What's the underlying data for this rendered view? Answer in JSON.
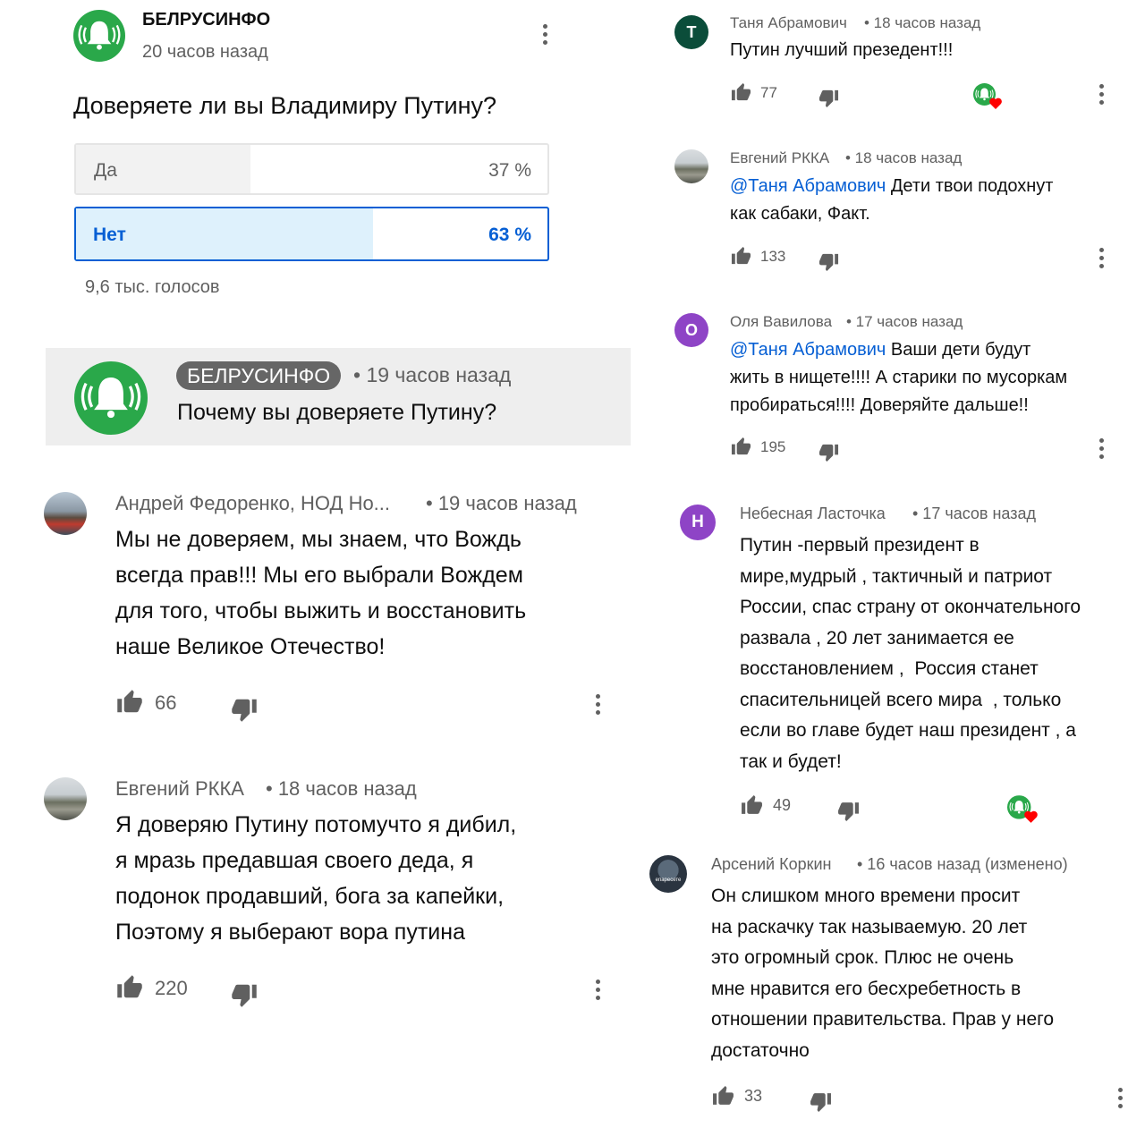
{
  "poll": {
    "channel": "БЕЛРУСИНФО",
    "time": "20 часов назад",
    "question": "Доверяете ли вы Владимиру Путину?",
    "options": [
      {
        "label": "Да",
        "percent_text": "37 %",
        "percent": 37
      },
      {
        "label": "Нет",
        "percent_text": "63 %",
        "percent": 63
      }
    ],
    "votes": "9,6 тыс. голосов"
  },
  "post": {
    "channel": "БЕЛРУСИНФО",
    "time": "• 19 часов назад",
    "text": "Почему вы доверяете Путину?"
  },
  "left_comments": [
    {
      "author": "Андрей Федоренко, НОД Но...",
      "time": "• 19 часов назад",
      "lines": [
        "Мы не доверяем, мы знаем, что Вождь",
        "всегда прав!!! Мы его выбрали Вождем",
        "для того, чтобы выжить и восстановить",
        "наше Великое Отечество!"
      ],
      "likes": "66"
    },
    {
      "author": "Евгений РККА",
      "time": "• 18 часов назад",
      "lines": [
        "Я доверяю Путину потомучто я дибил,",
        "я мразь предавшая своего деда, я",
        "подонок продавший, бога за капейки,",
        "Поэтому я выберают вора путина"
      ],
      "likes": "220"
    }
  ],
  "right_comments": [
    {
      "avatar_letter": "Т",
      "avatar_color": "#0b4d3a",
      "author": "Таня Абрамович",
      "time": "• 18 часов назад",
      "mention": "",
      "lines": [
        "Путин лучший презедент!!!"
      ],
      "likes": "77"
    },
    {
      "author": "Евгений РККА",
      "time": "• 18 часов назад",
      "mention": "@Таня Абрамович",
      "first": " Дети твои подохнут",
      "lines": [
        "как сабаки, Факт."
      ],
      "likes": "133"
    },
    {
      "avatar_letter": "О",
      "avatar_color": "#8e44c6",
      "author": "Оля Вавилова",
      "time": "• 17 часов назад",
      "mention": "@Таня Абрамович",
      "first": " Ваши дети будут",
      "lines": [
        "жить в нищете!!!! А старики по мусоркам",
        "пробираться!!!! Доверяйте дальше!!"
      ],
      "likes": "195"
    },
    {
      "avatar_letter": "Н",
      "avatar_color": "#8e44c6",
      "author": "Небесная Ласточка",
      "time": "• 17 часов назад",
      "lines": [
        "Путин -первый президент в",
        "мире,мудрый , тактичный и патриот",
        "России, спас страну от окончательного",
        "развала , 20 лет занимается ее",
        "восстановлением ,  Россия станет",
        "спасительницей всего мира  , только",
        "если во главе будет наш президент , а",
        "так и будет!"
      ],
      "likes": "49"
    },
    {
      "author": "Арсений Коркин",
      "time": "• 16 часов назад (изменено)",
      "avatar_text": "епаресете",
      "lines": [
        "Он слишком много времени просит",
        "на раскачку так называемую. 20 лет",
        "это огромный срок. Плюс не очень",
        "мне нравится его бесхребетность в",
        "отношении правительства. Прав у него",
        "достаточно"
      ],
      "likes": "33"
    }
  ],
  "colors": {
    "brand_green": "#2aa84a",
    "accent_blue": "#065fd4",
    "poll_blue_fill": "#def1fc",
    "heart": "#ff0000"
  }
}
